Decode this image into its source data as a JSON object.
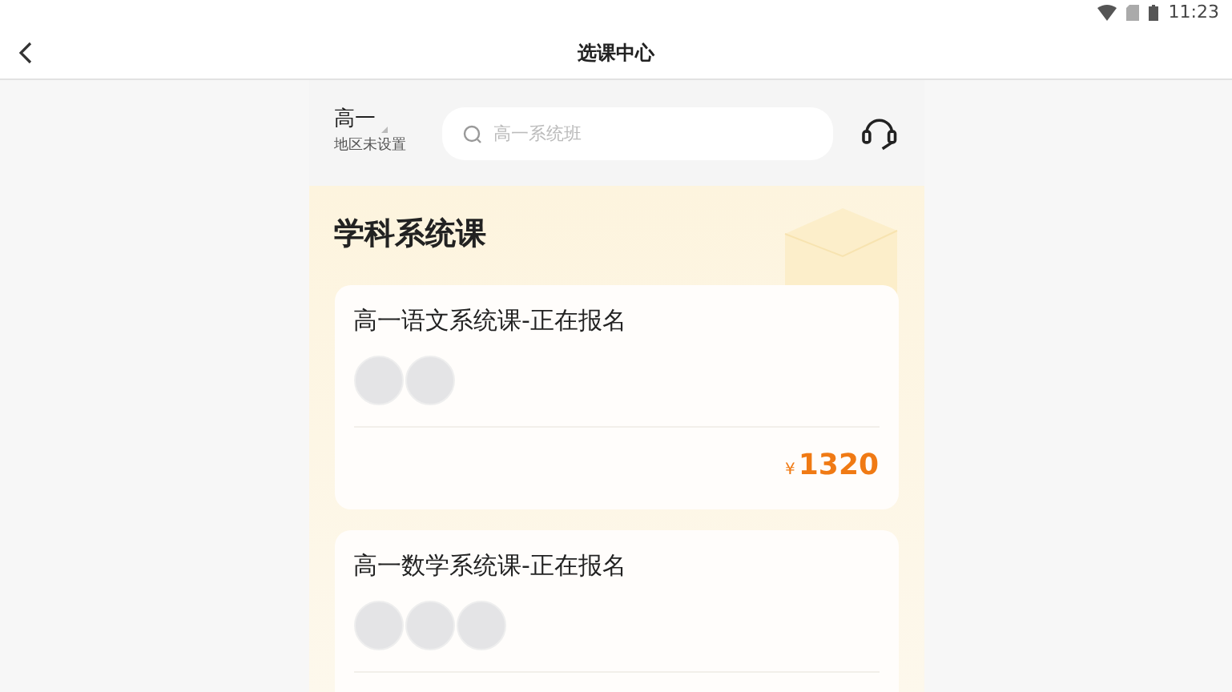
{
  "status_bar": {
    "time": "11:23"
  },
  "header": {
    "title": "选课中心"
  },
  "filter": {
    "grade": "高一",
    "region": "地区未设置",
    "search": {
      "placeholder": "高一系统班"
    }
  },
  "section": {
    "title": "学科系统课"
  },
  "courses": [
    {
      "title": "高一语文系统课-正在报名",
      "avatars": [
        {
          "kind": "photo"
        },
        {
          "kind": "photo"
        }
      ],
      "currency": "¥",
      "price": "1320"
    },
    {
      "title": "高一数学系统课-正在报名",
      "avatars": [
        {
          "kind": "photo"
        },
        {
          "kind": "photo"
        },
        {
          "kind": "photo"
        }
      ]
    }
  ]
}
